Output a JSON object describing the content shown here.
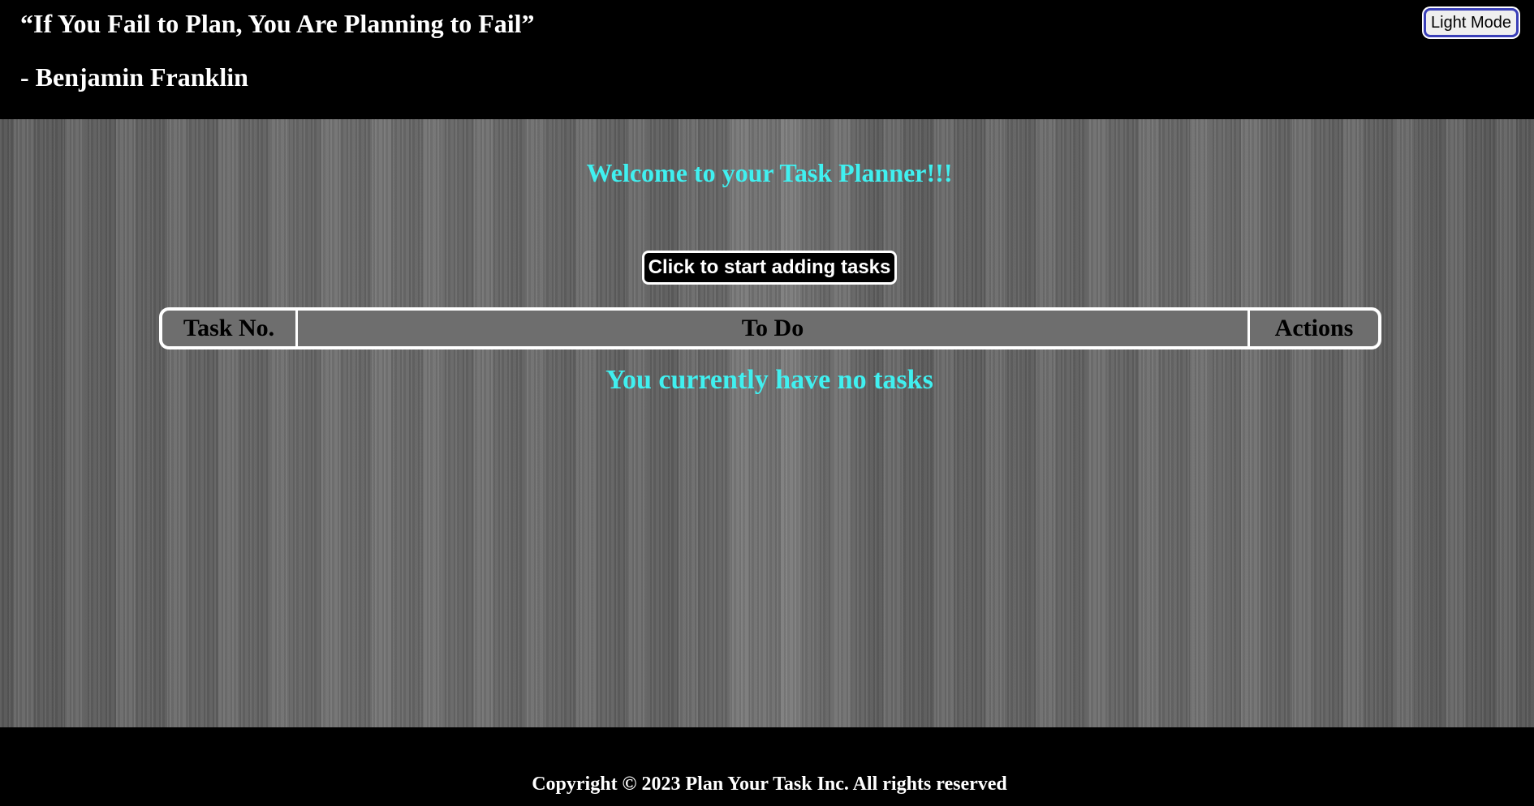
{
  "header": {
    "quote": "“If You Fail to Plan, You Are Planning to Fail”",
    "author": "- Benjamin Franklin",
    "mode_button_label": "Light Mode"
  },
  "main": {
    "welcome": "Welcome to your Task Planner!!!",
    "add_button_label": "Click to start adding tasks",
    "table": {
      "columns": [
        "Task No.",
        "To Do",
        "Actions"
      ]
    },
    "empty_message": "You currently have no tasks"
  },
  "footer": {
    "copyright": "Copyright © 2023 Plan Your Task Inc. All rights reserved"
  },
  "colors": {
    "accent": "#40f0f0",
    "header_bg": "#000000",
    "button_border": "#3a3fb8"
  }
}
